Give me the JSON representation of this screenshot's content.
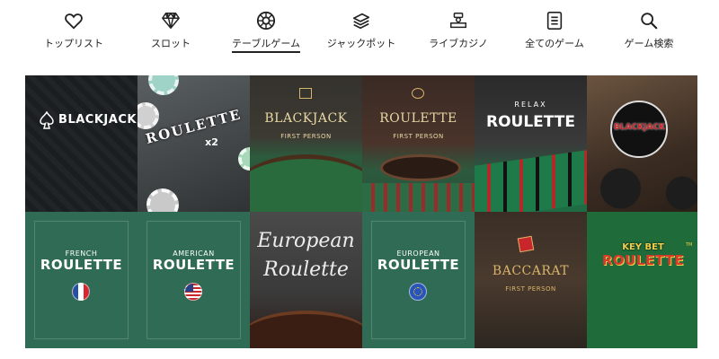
{
  "nav": {
    "items": [
      {
        "label": "トップリスト",
        "icon": "heart-icon"
      },
      {
        "label": "スロット",
        "icon": "diamond-icon"
      },
      {
        "label": "テーブルゲーム",
        "icon": "roulette-wheel-icon",
        "active": true
      },
      {
        "label": "ジャックポット",
        "icon": "money-stack-icon"
      },
      {
        "label": "ライブカジノ",
        "icon": "live-dealer-icon"
      },
      {
        "label": "全てのゲーム",
        "icon": "list-icon"
      },
      {
        "label": "ゲーム検索",
        "icon": "search-icon"
      }
    ]
  },
  "games": {
    "blackjack": {
      "title": "BLACKJACK"
    },
    "roulette_x2": {
      "title": "ROULETTE",
      "badge": "x2"
    },
    "blackjack_fp": {
      "title": "BLACKJACK",
      "sub": "FIRST PERSON"
    },
    "roulette_fp": {
      "title": "ROULETTE",
      "sub": "FIRST PERSON"
    },
    "relax_roulette": {
      "brand": "RELAX",
      "title": "ROULETTE"
    },
    "moto_blackjack": {
      "title": "BLACKJACK"
    },
    "french_roulette": {
      "kicker": "FRENCH",
      "title": "ROULETTE"
    },
    "american_roulette": {
      "kicker": "AMERICAN",
      "title": "ROULETTE"
    },
    "european_roulette_script": {
      "line1": "European",
      "line2": "Roulette"
    },
    "european_roulette": {
      "kicker": "EUROPEAN",
      "title": "ROULETTE"
    },
    "baccarat_fp": {
      "title": "BACCARAT",
      "sub": "FIRST PERSON"
    },
    "keybet_roulette": {
      "line1": "KEY BET",
      "line2": "ROULETTE",
      "tm": "TM"
    }
  },
  "colors": {
    "felt_green": "#2f6b55",
    "nav_text": "#222222",
    "gold": "#d8b36a"
  }
}
